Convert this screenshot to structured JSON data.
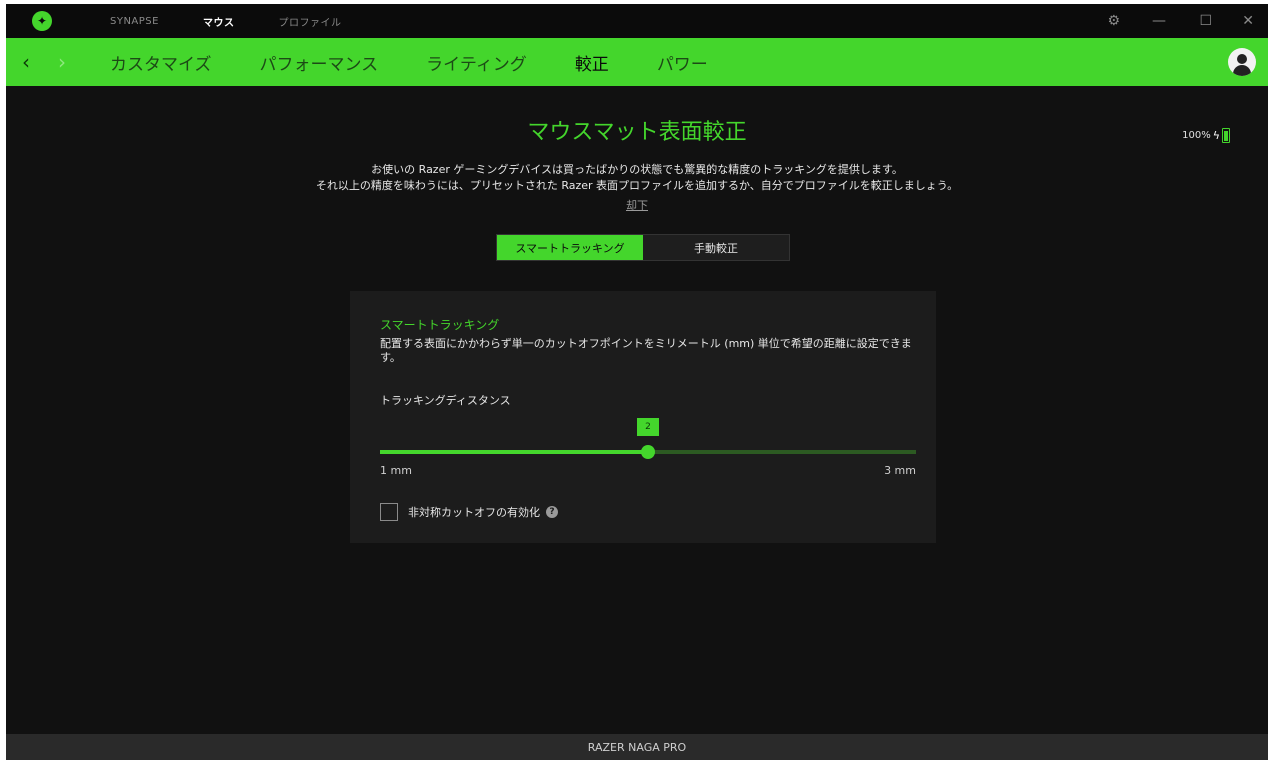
{
  "titlebar": {
    "tabs": [
      "SYNAPSE",
      "マウス",
      "プロファイル"
    ],
    "active_tab": "マウス"
  },
  "nav": {
    "tabs": [
      "カスタマイズ",
      "パフォーマンス",
      "ライティング",
      "較正",
      "パワー"
    ],
    "active_tab": "較正"
  },
  "battery": {
    "label": "100%",
    "level": 1.0
  },
  "page": {
    "title": "マウスマット表面較正",
    "description_line1": "お使いの Razer ゲーミングデバイスは買ったばかりの状態でも驚異的な精度のトラッキングを提供します。",
    "description_line2": "それ以上の精度を味わうには、プリセットされた Razer 表面プロファイルを追加するか、自分でプロファイルを較正しましょう。",
    "learn_more": "却下"
  },
  "segment": {
    "options": [
      "スマートトラッキング",
      "手動較正"
    ],
    "selected": "スマートトラッキング"
  },
  "card": {
    "title": "スマートトラッキング",
    "description": "配置する表面にかかわらず単一のカットオフポイントをミリメートル (mm) 単位で希望の距離に設定できます。",
    "subheading": "トラッキングディスタンス",
    "slider": {
      "value": 2,
      "value_label": "2",
      "min": 1,
      "max": 3,
      "min_label": "1 mm",
      "max_label": "3 mm"
    },
    "checkbox_label": "非対称カットオフの有効化",
    "checkbox_checked": false
  },
  "footer": {
    "device_name": "RAZER NAGA PRO"
  },
  "colors": {
    "accent": "#44d62c",
    "background": "#111111",
    "card": "#1c1c1c"
  },
  "icons": [
    "razer-logo-icon",
    "settings-icon",
    "minimize-icon",
    "maximize-icon",
    "close-icon",
    "back-arrow-icon",
    "forward-arrow-icon",
    "user-avatar-icon",
    "battery-icon",
    "charging-bolt-icon",
    "help-icon"
  ]
}
